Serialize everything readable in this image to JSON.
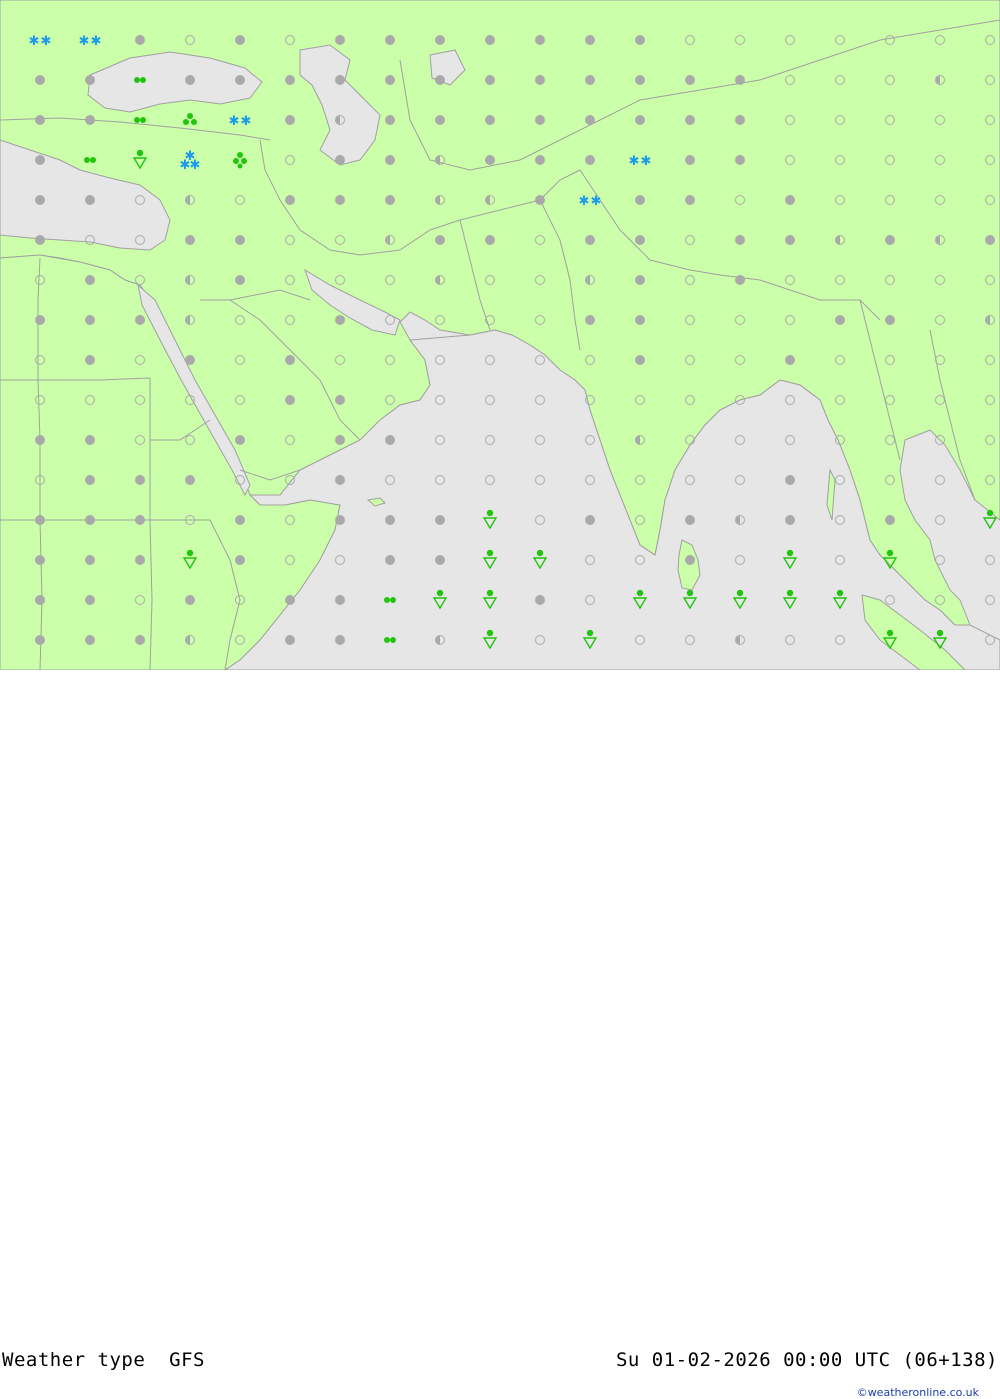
{
  "footer": {
    "title": "Weather type",
    "model": "GFS",
    "datetime": "Su 01-02-2026 00:00 UTC (06+138)",
    "credit": "©weatheronline.co.uk"
  },
  "colors": {
    "land": "#ccff aa",
    "water": "#e6e6e6",
    "border": "#a0a0a0",
    "clear_dot": "#a9a9a9",
    "rain": "#22c40f",
    "snow": "#1e9be8"
  },
  "legend_symbols": [
    "cloudy-dot",
    "clear-circle",
    "partly-cloudy-half-circle",
    "drizzle",
    "showers",
    "snow",
    "snow-showers",
    "rain-showers"
  ],
  "grid": {
    "columns": 19,
    "rows": 16,
    "rows_symbols": [
      "S S D O D O D D D D D D D O O O O O O O",
      "D D C D D D D D D D D D D D D O O O H O",
      "D D R T S D H D D D D D D D D O O O O O",
      "D R V N Q O D D H D D D S D D O O O O O",
      "D D O H O D D D H H D S D D O D O O O O",
      "D O O D D O O H D D O D D O D D H D H D",
      "O D O H D O O O H O O H D O D O O O O O",
      "D D D H O O D O O O O D D O O O D D O H",
      "O D O D O D O O O O O O D O O D O O O O",
      "O O O O O D D O O O O O O O O O O O O O",
      "D D O O D O D D O O O O H O O O O O O O",
      "O D D D O O D O O O O O O O O D O O O O",
      "D D D O D O D D D V O D O D H D O D O V",
      "D D D V D O O D D V V O O D O V O V O O",
      "D D O D O D D R V V D O V V V V V O O O",
      "D D D H O D D R H V O V O O H O O V V O"
    ]
  }
}
